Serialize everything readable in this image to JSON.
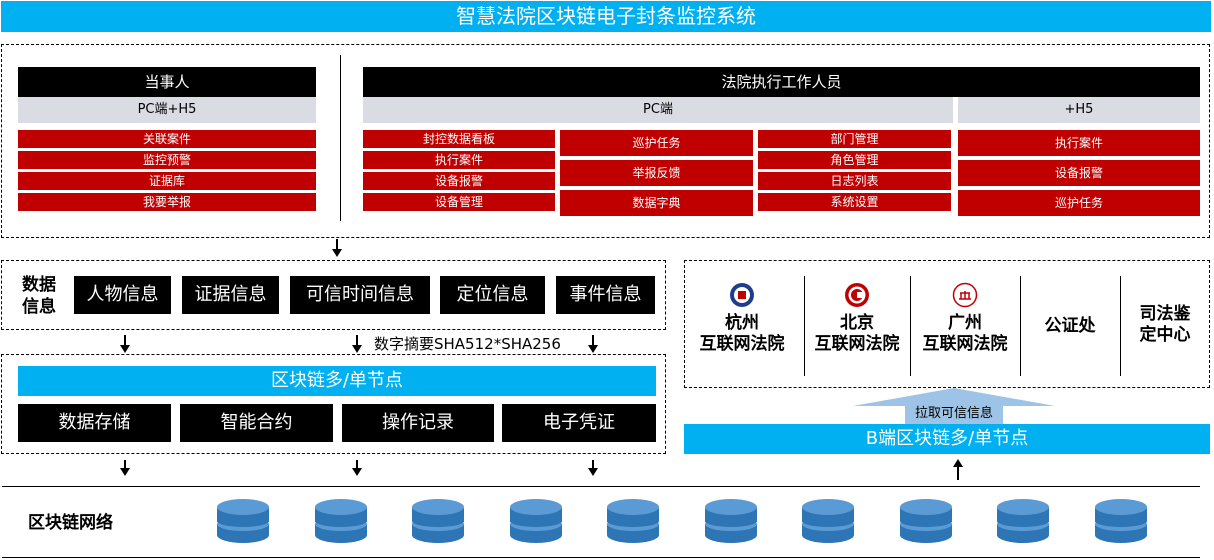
{
  "title": "智慧法院区块链电子封条监控系统",
  "party": {
    "header": "当事人",
    "platform": "PC端+H5",
    "items": [
      "关联案件",
      "监控预警",
      "证据库",
      "我要举报"
    ]
  },
  "court_staff": {
    "header": "法院执行工作人员",
    "pc_label": "PC端",
    "h5_label": "+H5",
    "pc_col1": [
      "封控数据看板",
      "执行案件",
      "设备报警",
      "设备管理"
    ],
    "pc_col2": [
      "巡护任务",
      "举报反馈",
      "数据字典"
    ],
    "pc_col3": [
      "部门管理",
      "角色管理",
      "日志列表",
      "系统设置"
    ],
    "h5_items": [
      "执行案件",
      "设备报警",
      "巡护任务"
    ]
  },
  "data_info": {
    "label_line1": "数据",
    "label_line2": "信息",
    "items": [
      "人物信息",
      "证据信息",
      "可信时间信息",
      "定位信息",
      "事件信息"
    ]
  },
  "digest_label": "数字摘要SHA512*SHA256",
  "chain": {
    "header": "区块链多/单节点",
    "items": [
      "数据存储",
      "智能合约",
      "操作记录",
      "电子凭证"
    ]
  },
  "courts": [
    {
      "line1": "杭州",
      "line2": "互联网法院",
      "emblem": "hangzhou-court-emblem-icon"
    },
    {
      "line1": "北京",
      "line2": "互联网法院",
      "emblem": "beijing-court-emblem-icon"
    },
    {
      "line1": "广州",
      "line2": "互联网法院",
      "emblem": "guangzhou-court-emblem-icon"
    },
    {
      "line1": "公证处",
      "line2": ""
    },
    {
      "line1": "司法鉴",
      "line2": "定中心"
    }
  ],
  "pull_label": "拉取可信信息",
  "b_chain_label": "B端区块链多/单节点",
  "network_label": "区块链网络",
  "colors": {
    "blue": "#00b0f0",
    "red": "#c00000",
    "black": "#000000",
    "grey": "#d9dce3",
    "db_blue": "#2e75b6"
  }
}
